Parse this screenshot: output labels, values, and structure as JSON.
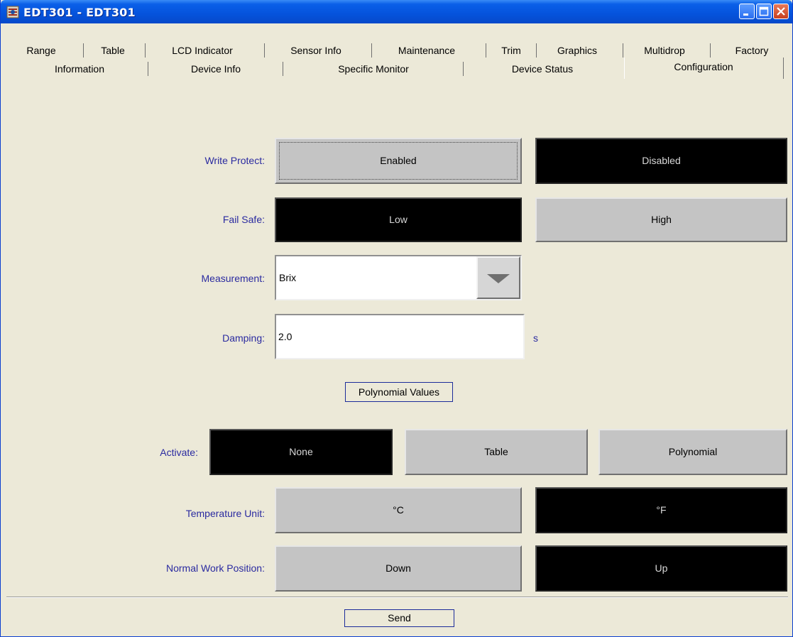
{
  "window": {
    "title": "EDT301 - EDT301"
  },
  "tabs": {
    "row1": [
      "Range",
      "Table",
      "LCD Indicator",
      "Sensor Info",
      "Maintenance",
      "Trim",
      "Graphics",
      "Multidrop",
      "Factory"
    ],
    "row2": [
      "Information",
      "Device Info",
      "Specific Monitor",
      "Device Status",
      "Configuration"
    ],
    "selected": "Configuration"
  },
  "form": {
    "write_protect": {
      "label": "Write Protect:",
      "enabled": "Enabled",
      "disabled": "Disabled",
      "selected": "Disabled"
    },
    "fail_safe": {
      "label": "Fail Safe:",
      "low": "Low",
      "high": "High",
      "selected": "Low"
    },
    "measurement": {
      "label": "Measurement:",
      "value": "Brix"
    },
    "damping": {
      "label": "Damping:",
      "value": "2.0",
      "unit": "s"
    },
    "polynomial_values_button": "Polynomial Values",
    "activate": {
      "label": "Activate:",
      "none": "None",
      "table": "Table",
      "polynomial": "Polynomial",
      "selected": "None"
    },
    "temperature_unit": {
      "label": "Temperature Unit:",
      "celsius": "°C",
      "fahrenheit": "°F",
      "selected": "°F"
    },
    "normal_work_position": {
      "label": "Normal Work Position:",
      "down": "Down",
      "up": "Up",
      "selected": "Up"
    }
  },
  "footer": {
    "send_button": "Send"
  },
  "colors": {
    "title_bar": "#0553dc",
    "label_text": "#2a2aa0",
    "selected_button": "#000000",
    "unselected_button": "#c4c4c4",
    "window_bg": "#ece9d8"
  },
  "icons": [
    "app-icon",
    "minimize-icon",
    "maximize-icon",
    "close-icon",
    "dropdown-arrow-icon"
  ]
}
